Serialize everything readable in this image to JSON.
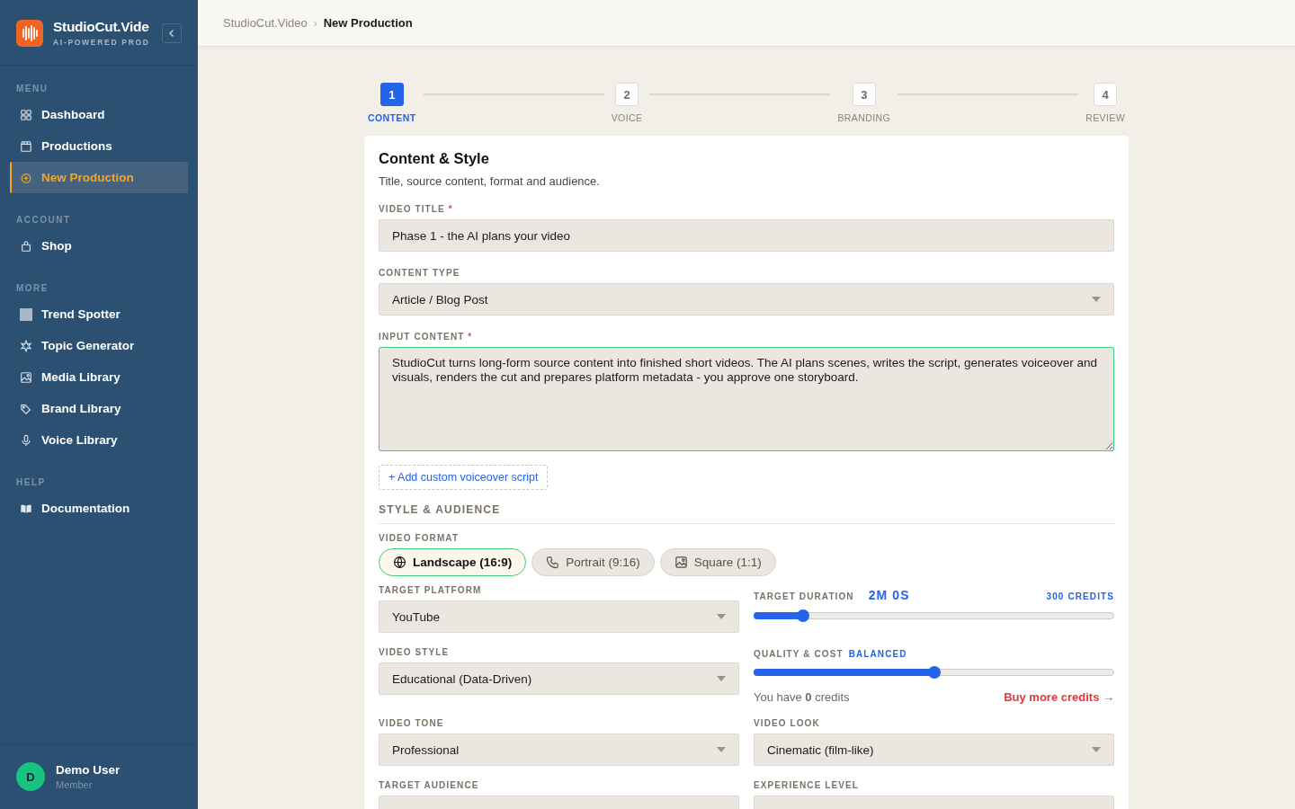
{
  "sidebar": {
    "brand": {
      "title": "StudioCut.Vide",
      "subtitle": "AI-POWERED PROD"
    },
    "sections": [
      {
        "label": "MENU",
        "items": [
          {
            "label": "Dashboard",
            "selected": false
          },
          {
            "label": "Productions",
            "selected": false
          },
          {
            "label": "New Production",
            "selected": true
          }
        ]
      },
      {
        "label": "ACCOUNT",
        "items": [
          {
            "label": "Shop",
            "selected": false
          }
        ]
      },
      {
        "label": "MORE",
        "items": [
          {
            "label": "Trend Spotter",
            "selected": false
          },
          {
            "label": "Topic Generator",
            "selected": false
          },
          {
            "label": "Media Library",
            "selected": false
          },
          {
            "label": "Brand Library",
            "selected": false
          },
          {
            "label": "Voice Library",
            "selected": false
          }
        ]
      },
      {
        "label": "HELP",
        "items": [
          {
            "label": "Documentation",
            "selected": false
          }
        ]
      }
    ],
    "user": {
      "initial": "D",
      "name": "Demo User",
      "role": "Member"
    }
  },
  "breadcrumb": {
    "separator": "›",
    "items": [
      {
        "label": "StudioCut.Video",
        "current": false
      },
      {
        "label": "New Production",
        "current": true
      }
    ]
  },
  "stepper": [
    {
      "number": "1",
      "label": "CONTENT",
      "selected": true
    },
    {
      "number": "2",
      "label": "VOICE",
      "selected": false
    },
    {
      "number": "3",
      "label": "BRANDING",
      "selected": false
    },
    {
      "number": "4",
      "label": "REVIEW",
      "selected": false
    }
  ],
  "form": {
    "title": "Content & Style",
    "subtitle": "Title, source content, format and audience.",
    "video_title": {
      "label": "VIDEO TITLE",
      "required_mark": "*",
      "value": "Phase 1 - the AI plans your video"
    },
    "content_type": {
      "label": "CONTENT TYPE",
      "value": "Article / Blog Post"
    },
    "input_content": {
      "label": "INPUT CONTENT",
      "required_mark": "*",
      "value": "StudioCut turns long-form source content into finished short videos. The AI plans scenes, writes the script, generates voiceover and visuals, renders the cut and prepares platform metadata - you approve one storyboard."
    },
    "add_script": "+ Add custom voiceover script",
    "section_heading": "STYLE & AUDIENCE",
    "video_format": {
      "label": "VIDEO FORMAT",
      "options": [
        {
          "label": "Landscape (16:9)",
          "selected": true
        },
        {
          "label": "Portrait (9:16)",
          "selected": false
        },
        {
          "label": "Square (1:1)",
          "selected": false
        }
      ]
    },
    "target_platform": {
      "label": "TARGET PLATFORM",
      "value": "YouTube"
    },
    "target_duration": {
      "label": "TARGET DURATION",
      "reading": "2M 0S",
      "credits": "300 CREDITS",
      "level": 0.135
    },
    "video_style": {
      "label": "VIDEO STYLE",
      "value": "Educational (Data-Driven)"
    },
    "quality": {
      "label": "QUALITY & COST",
      "reading": "BALANCED",
      "level": 0.5
    },
    "credits_note": "You have **0** credits",
    "buy_link": "Buy more credits →",
    "video_tone": {
      "label": "VIDEO TONE",
      "value": "Professional"
    },
    "video_look": {
      "label": "VIDEO LOOK",
      "value": "Cinematic (film-like)"
    },
    "target_audience": {
      "label": "TARGET AUDIENCE"
    },
    "experience_level": {
      "label": "EXPERIENCE LEVEL"
    }
  }
}
